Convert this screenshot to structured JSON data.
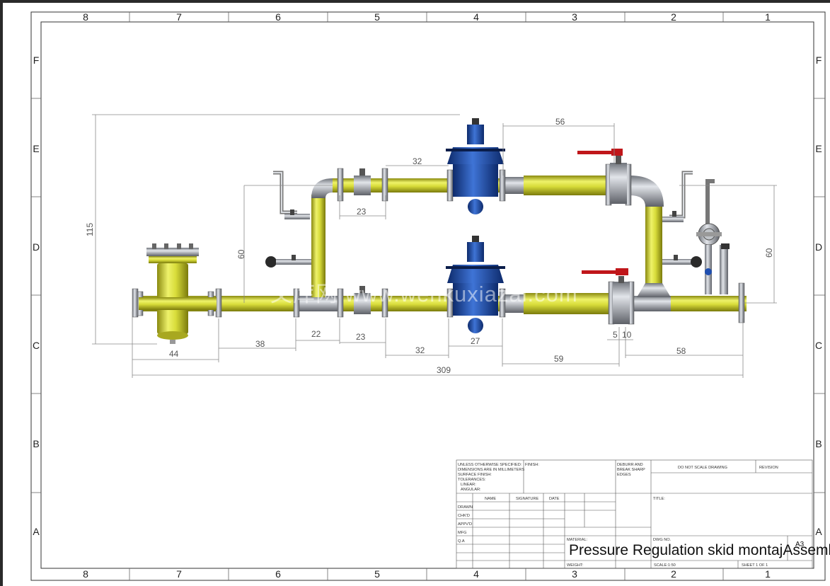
{
  "sheet": {
    "zones_top": [
      "8",
      "7",
      "6",
      "5",
      "4",
      "3",
      "2",
      "1"
    ],
    "zones_side": [
      "F",
      "E",
      "D",
      "C",
      "B",
      "A"
    ]
  },
  "dimensions": {
    "d56": "56",
    "d32_top": "32",
    "d23_top": "23",
    "d115": "115",
    "d60_left": "60",
    "d60_right": "60",
    "d44": "44",
    "d38": "38",
    "d22": "22",
    "d23_bot": "23",
    "d32_bot": "32",
    "d27": "27",
    "d5": "5",
    "d10": "10",
    "d59": "59",
    "d58": "58",
    "d309": "309"
  },
  "watermark": "文库网 www.wenkuxiazai.com",
  "title_block": {
    "general_notes": [
      "UNLESS OTHERWISE SPECIFIED:",
      "DIMENSIONS ARE IN MILLIMETERS",
      "SURFACE FINISH:",
      "TOLERANCES:",
      "  LINEAR:",
      "  ANGULAR:"
    ],
    "finish": "FINISH:",
    "deburr": [
      "DEBURR AND",
      "BREAK SHARP",
      "EDGES"
    ],
    "do_not_scale": "DO NOT SCALE DRAWING",
    "revision": "REVISION",
    "col_name": "NAME",
    "col_signature": "SIGNATURE",
    "col_date": "DATE",
    "rows": [
      "DRAWN",
      "CHK'D",
      "APPV'D",
      "MFG",
      "Q.A"
    ],
    "title_label": "TITLE:",
    "material": "MATERIAL:",
    "dwg_no": "DWG NO.",
    "drawing_title": "Pressure Regulation skid montajAssembly",
    "size": "A3",
    "weight": "WEIGHT:",
    "scale": "SCALE:1:50",
    "sheet_of": "SHEET 1 OF 1"
  }
}
